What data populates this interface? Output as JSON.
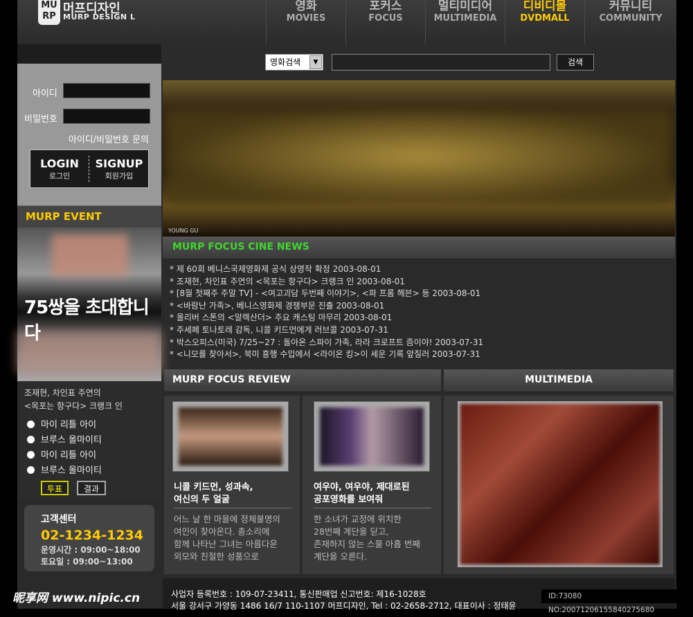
{
  "header": {
    "logo_mark": "MU RP",
    "logo_name": "머프디자인",
    "logo_sub": "MURP DESIGN L",
    "nav": [
      {
        "ko": "영화",
        "en": "MOVIES"
      },
      {
        "ko": "포커스",
        "en": "FOCUS"
      },
      {
        "ko": "멀티미디어",
        "en": "MULTIMEDIA"
      },
      {
        "ko": "디비디몰",
        "en": "DVDMALL"
      },
      {
        "ko": "커뮤니티",
        "en": "COMMUNITY"
      }
    ],
    "active_color": "#ffcc00"
  },
  "login": {
    "id_label": "아이디",
    "pw_label": "비밀번호",
    "find_link": "아이디/비밀번호 문의",
    "login_en": "LOGIN",
    "login_ko": "로그인",
    "signup_en": "SIGNUP",
    "signup_ko": "회원가입"
  },
  "event": {
    "title": "MURP EVENT",
    "headline": "75쌍을 초대합니다"
  },
  "poll": {
    "question_line1": "조재현, 차인표 주연의",
    "question_line2": "<목포는 항구다> 크랭크 인",
    "options": [
      "마이 리틀 아이",
      "브루스 올마이티",
      "마이 리틀 아이",
      "브루스 올마이티"
    ],
    "vote_label": "투표",
    "result_label": "결과"
  },
  "customer_center": {
    "title": "고객센터",
    "phone": "02-1234-1234",
    "hours_weekday": "운영시간 : 09:00~18:00",
    "hours_saturday": "토요일 : 09:00~13:00"
  },
  "search": {
    "category": "영화검색",
    "button": "검색",
    "query": ""
  },
  "banner": {
    "small_text": "YOUNG GU"
  },
  "news": {
    "title": "MURP FOCUS CINE NEWS",
    "items": [
      "* 제 60회 베니스국제영화제 공식 상영작 확정 2003-08-01",
      "* 조재현, 차인표 주연의 <목포는 항구다> 크랭크 인 2003-08-01",
      "* [8월 첫째주 주말 TV] - <여고괴담 두번째 이야기>, <파 프롬 헤븐> 등 2003-08-01",
      "* <바람난 가족>, 베니스영화제 경쟁부문 진출 2003-08-01",
      "* 올리버 스톤의 <알렉산더> 주요 캐스팅 마무리 2003-08-01",
      "* 주세페 토나토레 감독, 니콜 키드먼에게 러브콜 2003-07-31",
      "* 박스오피스(미국) 7/25~27 : 돌아온 스파이 가족, 라라 크로프트 즘이야! 2003-07-31",
      "* <니모를 찾아서>, 북미 흥행 수입에서 <라이온 킹>이 세운 기록 앞질러 2003-07-31"
    ]
  },
  "review": {
    "title": "MURP FOCUS REVIEW",
    "items": [
      {
        "title_line1": "니콜 키드먼, 성과속,",
        "title_line2": "여신의 두 얼굴",
        "desc": [
          "어느 날 한 마을에 정체불명의",
          "여인이 찾아온다. 총소리에",
          "함께 나타난 그녀는 아름다운",
          "외모와 친절한 성품으로"
        ]
      },
      {
        "title_line1": "여우야, 여우야, 제대로된",
        "title_line2": "공포영화를 보여줘",
        "desc": [
          "한 소녀가 교정에 위치한",
          "28번째 계단을 딛고,",
          "존재하지 않는 스물 아홉 번째",
          "계단을 오른다."
        ]
      }
    ]
  },
  "multimedia": {
    "title": "MULTIMEDIA"
  },
  "footer": {
    "line1": "사업자 등록번호 : 109-07-23411, 통신판매업 신고번호: 제16-1028호",
    "line2": "서울 강서구 가양동 1486 16/7 110-1107 머프디자인, Tel : 02-2658-2712, 대표이사 : 정태윤"
  },
  "watermark": {
    "site": "昵享网 www.nipic.cn",
    "id_text": "ID:73080 NO:20071206155840275680"
  }
}
